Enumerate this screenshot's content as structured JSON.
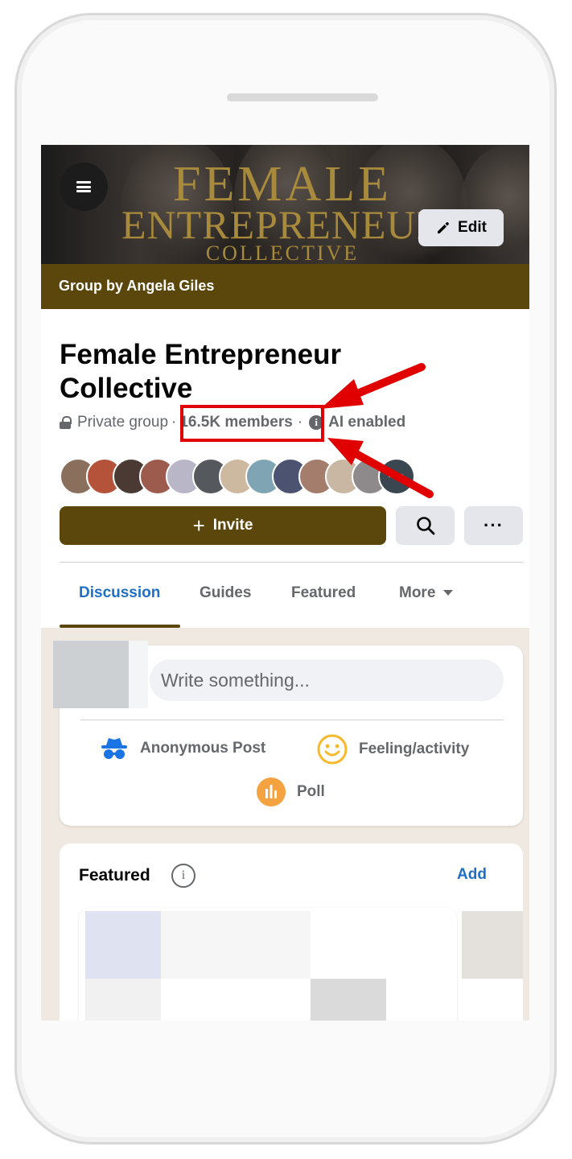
{
  "cover": {
    "title_line1": "FEMALE",
    "title_line2": "ENTREPRENEUR",
    "title_line3": "COLLECTIVE",
    "edit_label": "Edit",
    "menu_icon": "hamburger-menu-icon",
    "edit_icon": "pencil-icon"
  },
  "group_by": "Group by Angela Giles",
  "group": {
    "name": "Female Entrepreneur Collective",
    "privacy": "Private group",
    "separator": "·",
    "members": "16.5K members",
    "ai": "AI enabled"
  },
  "actions": {
    "invite_label": "Invite",
    "invite_icon": "+",
    "search_icon": "search-icon",
    "more_label": "···"
  },
  "tabs": [
    {
      "label": "Discussion",
      "active": true
    },
    {
      "label": "Guides"
    },
    {
      "label": "Featured"
    },
    {
      "label": "More"
    }
  ],
  "composer": {
    "placeholder": "Write something...",
    "anonymous": "Anonymous Post",
    "feeling": "Feeling/activity",
    "poll": "Poll"
  },
  "featured": {
    "title": "Featured",
    "info": "i",
    "add_label": "Add"
  },
  "colors": {
    "brand": "#5b460b",
    "link": "#1f6fc5",
    "annotation": "#e00000"
  }
}
